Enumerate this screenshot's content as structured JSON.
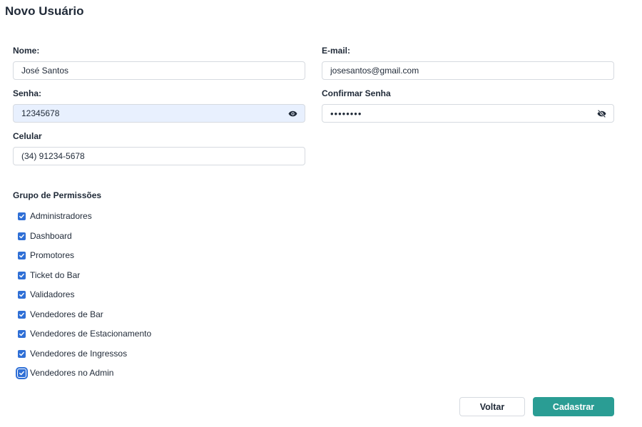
{
  "page": {
    "title": "Novo Usuário"
  },
  "form": {
    "name": {
      "label": "Nome:",
      "value": "José Santos"
    },
    "email": {
      "label": "E-mail:",
      "value": "josesantos@gmail.com"
    },
    "password": {
      "label": "Senha:",
      "value": "12345678",
      "visible": true,
      "icon": "eye-icon"
    },
    "confirm_password": {
      "label": "Confirmar Senha",
      "value": "12345678",
      "visible": false,
      "icon": "eye-off-icon"
    },
    "phone": {
      "label": "Celular",
      "value": "(34) 91234-5678"
    }
  },
  "permissions": {
    "title": "Grupo de Permissões",
    "items": [
      {
        "label": "Administradores",
        "checked": true
      },
      {
        "label": "Dashboard",
        "checked": true
      },
      {
        "label": "Promotores",
        "checked": true
      },
      {
        "label": "Ticket do Bar",
        "checked": true
      },
      {
        "label": "Validadores",
        "checked": true
      },
      {
        "label": "Vendedores de Bar",
        "checked": true
      },
      {
        "label": "Vendedores de Estacionamento",
        "checked": true
      },
      {
        "label": "Vendedores de Ingressos",
        "checked": true
      },
      {
        "label": "Vendedores no Admin",
        "checked": true
      }
    ]
  },
  "actions": {
    "back_label": "Voltar",
    "submit_label": "Cadastrar"
  },
  "colors": {
    "accent": "#2a9d94",
    "checkbox": "#2f6fd6",
    "autofill_bg": "#e8f0fe"
  }
}
